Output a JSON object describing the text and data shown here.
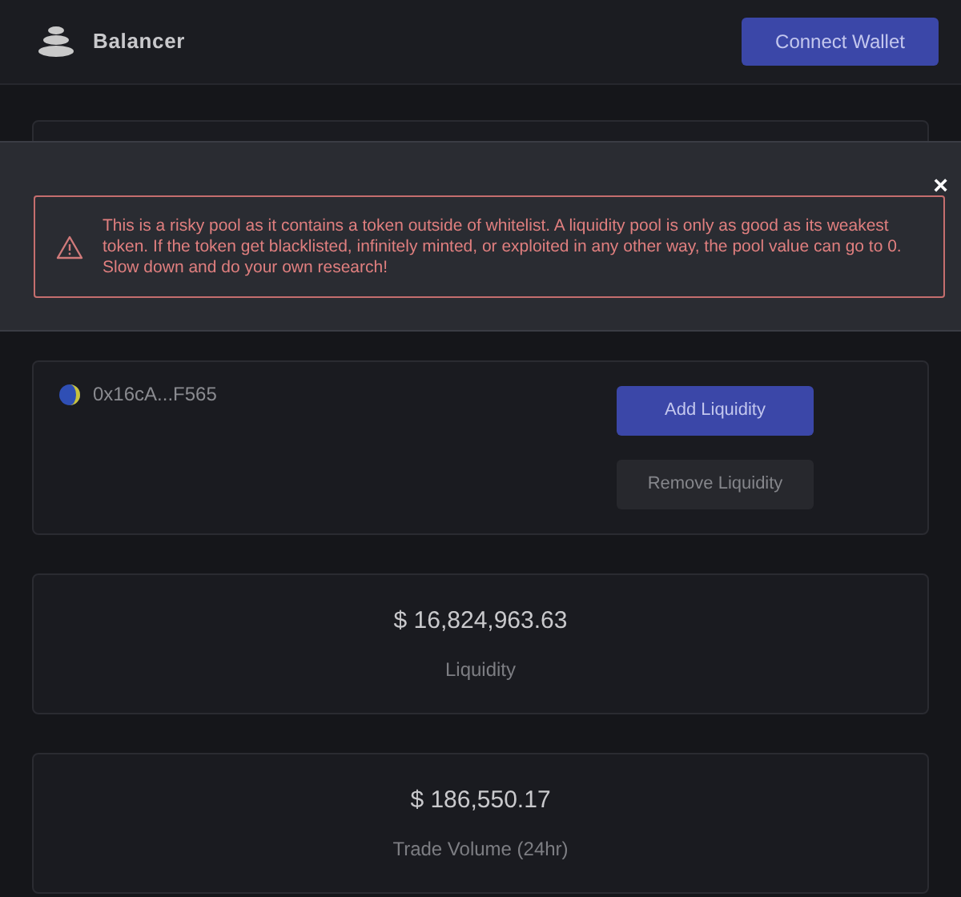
{
  "header": {
    "brand": "Balancer",
    "connect_button": "Connect Wallet"
  },
  "warning_banner": {
    "message": "This is a risky pool as it contains a token outside of whitelist. A liquidity pool is only as good as its weakest token. If the token get blacklisted, infinitely minted, or exploited in any other way, the pool value can go to 0. Slow down and do your own research!",
    "close_icon": "×"
  },
  "pool": {
    "address": "0x16cA...F565",
    "buttons": [
      {
        "label": "Add Liquidity",
        "disabled": false
      },
      {
        "label": "Remove Liquidity",
        "disabled": true
      }
    ]
  },
  "stats": [
    {
      "value": "$ 16,824,963.63",
      "label": "Liquidity"
    },
    {
      "value": "$ 186,550.17",
      "label": "Trade Volume (24hr)"
    }
  ]
}
